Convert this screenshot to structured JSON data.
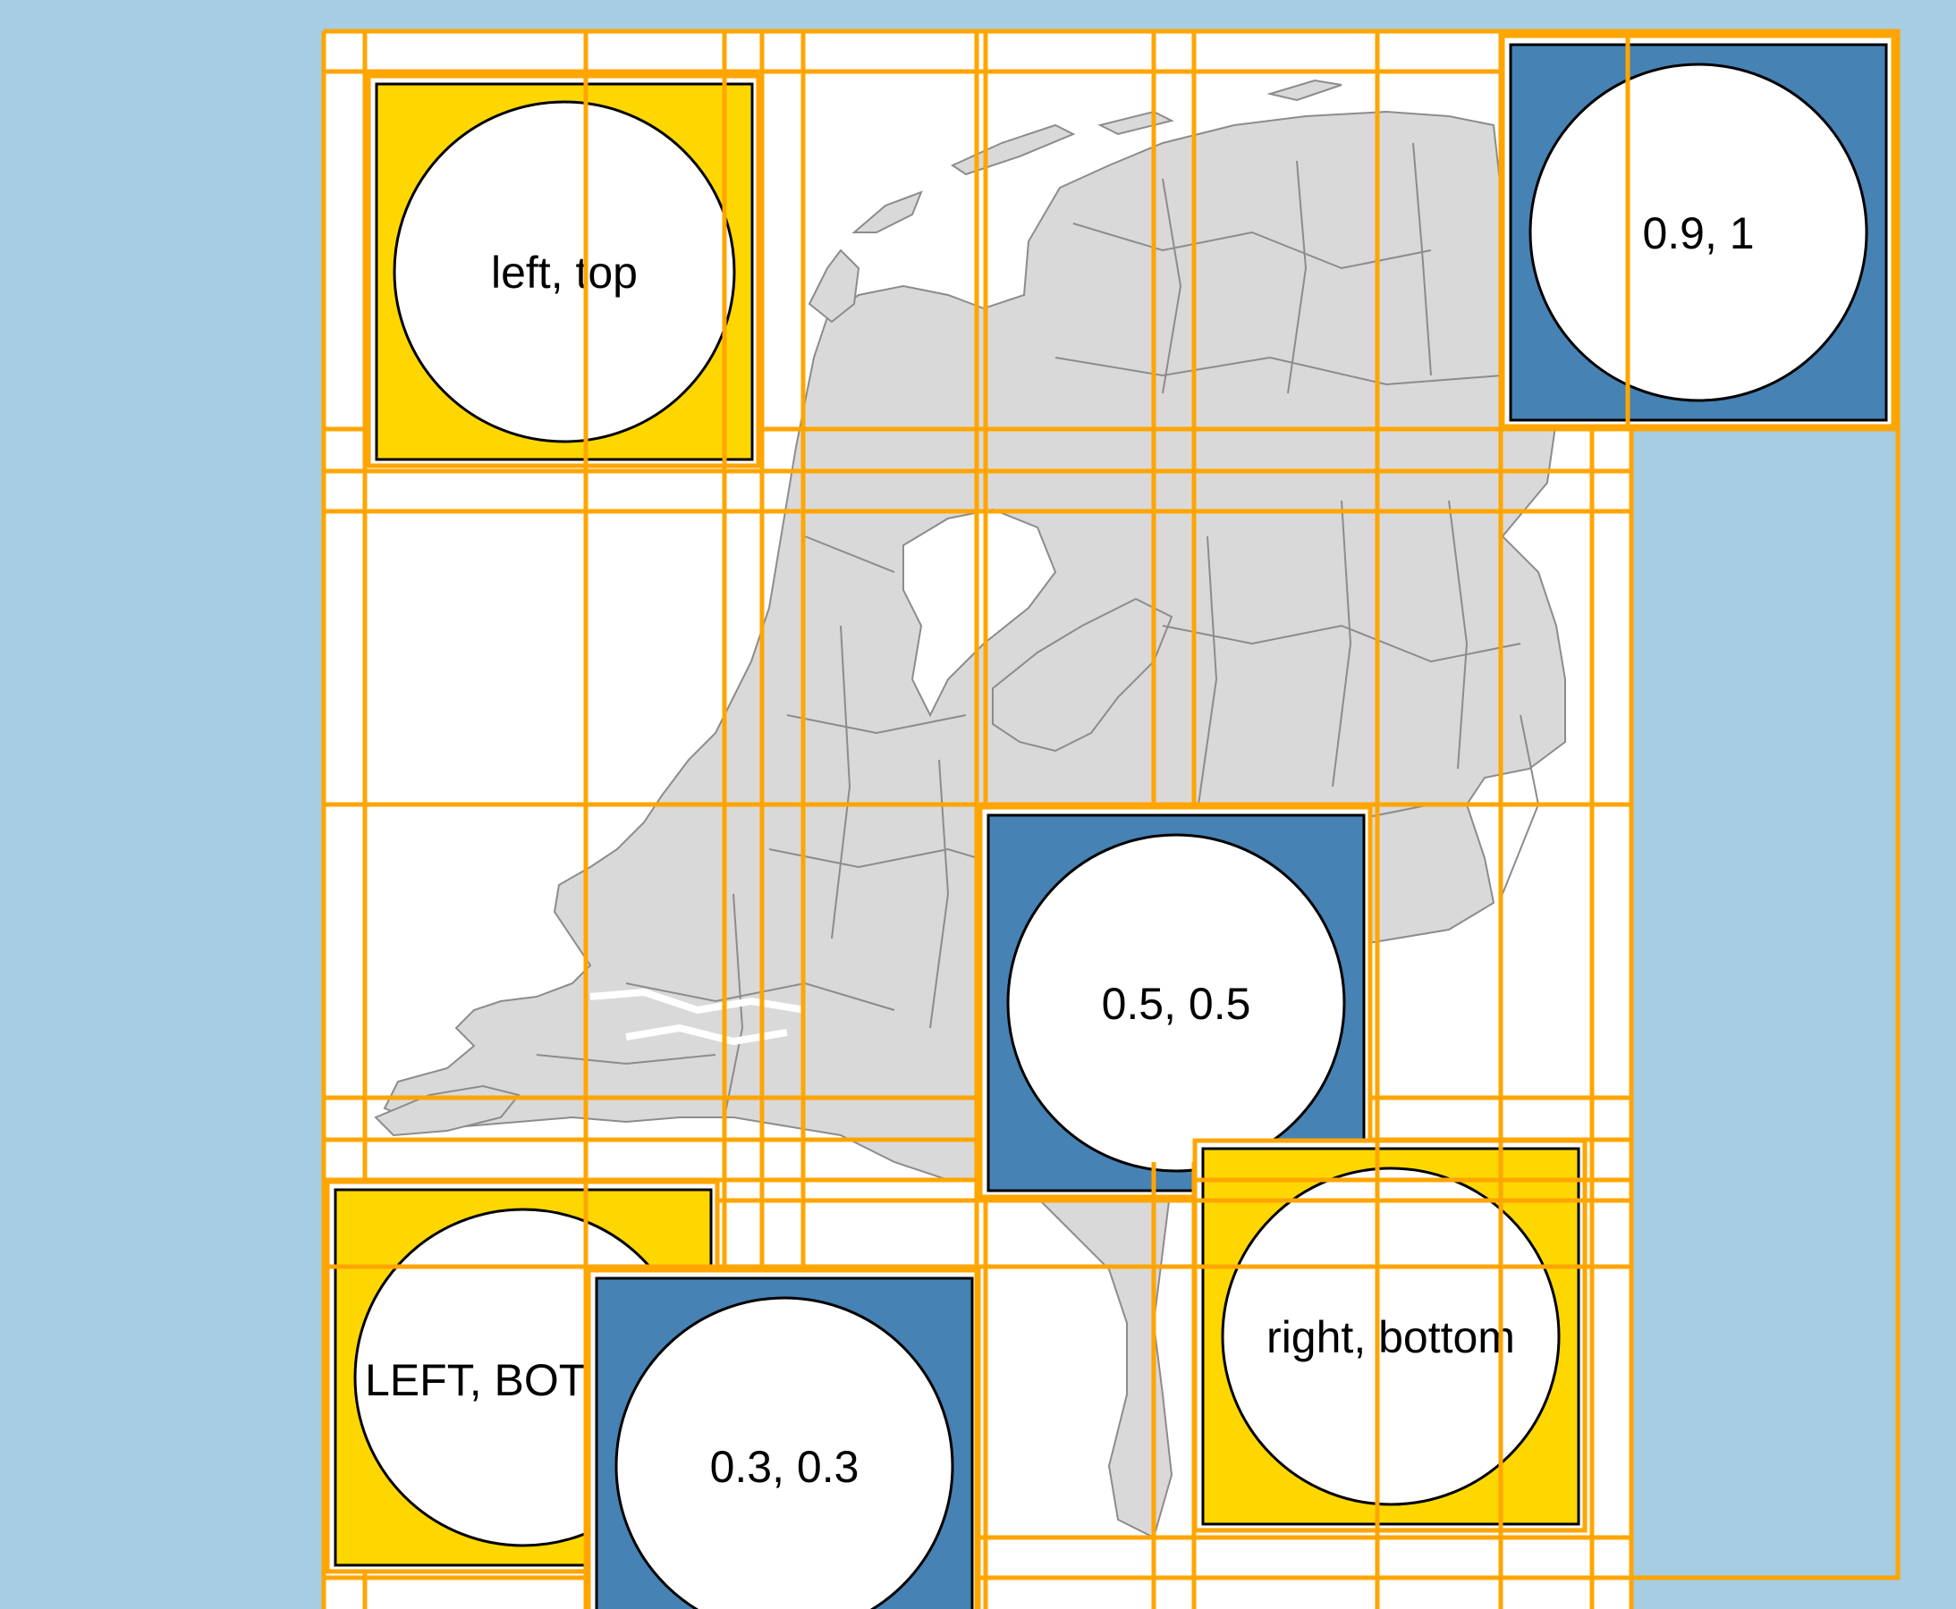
{
  "colors": {
    "sea": "#a6cde2",
    "map_background": "#ffffff",
    "land": "#d9d9d9",
    "land_border": "#8c8c8c",
    "grid_line": "#ffa500",
    "panel_yellow": "#ffd700",
    "panel_blue": "#4682b4",
    "circle_fill": "#ffffff",
    "outline": "#000000"
  },
  "insets": [
    {
      "id": "left-top",
      "label": "left, top",
      "fill": "#ffd700"
    },
    {
      "id": "top-right",
      "label": "0.9, 1",
      "fill": "#4682b4"
    },
    {
      "id": "center",
      "label": "0.5, 0.5",
      "fill": "#4682b4"
    },
    {
      "id": "left-bottom",
      "label": "LEFT, BOT",
      "fill": "#ffd700"
    },
    {
      "id": "point-three",
      "label": "0.3, 0.3",
      "fill": "#4682b4"
    },
    {
      "id": "right-bottom",
      "label": "right, bottom",
      "fill": "#ffd700"
    }
  ]
}
